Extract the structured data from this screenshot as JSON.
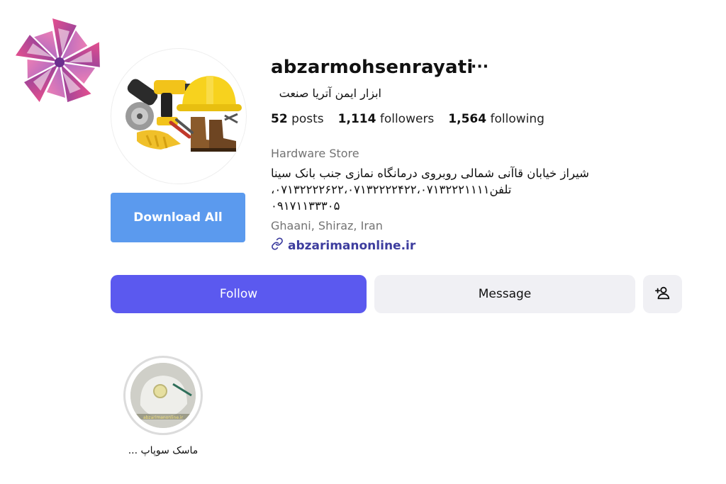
{
  "profile": {
    "username": "abzarmohsenrayati",
    "more_label": "···",
    "full_name": "ابزار ایمن آتریا صنعت",
    "stats": {
      "posts_count": "52",
      "posts_label": "posts",
      "followers_count": "1,114",
      "followers_label": "followers",
      "following_count": "1,564",
      "following_label": "following"
    },
    "category": "Hardware Store",
    "bio_lines": [
      "شیراز خیابان قاآنی شمالی روبروی درمانگاه نمازی جنب بانک سینا",
      "تلفن۰۷۱۳۲۲۲۲۶۲۲،۰۷۱۳۲۲۲۲۴۲۲،۰۷۱۳۲۲۲۱۱۱۱،",
      "۰۹۱۷۱۱۳۳۳۰۵"
    ],
    "address": "Ghaani, Shiraz, Iran",
    "website": "abzarimanonline.ir"
  },
  "buttons": {
    "download_all": "Download All",
    "follow": "Follow",
    "message": "Message"
  },
  "highlights": [
    {
      "label": "ماسک سوپاپ ...",
      "image_text": "abzarimanonline.ir"
    }
  ],
  "icons": {
    "logo": "pinwheel-star-logo",
    "avatar": "power-tools-hardhat-boots",
    "link": "link-icon",
    "add_user": "person-add-icon"
  },
  "colors": {
    "download_button": "#5b9aee",
    "follow_button": "#5b59ef",
    "secondary_button": "#f0f0f4",
    "link": "#3d3d9e",
    "muted_text": "#737373"
  }
}
